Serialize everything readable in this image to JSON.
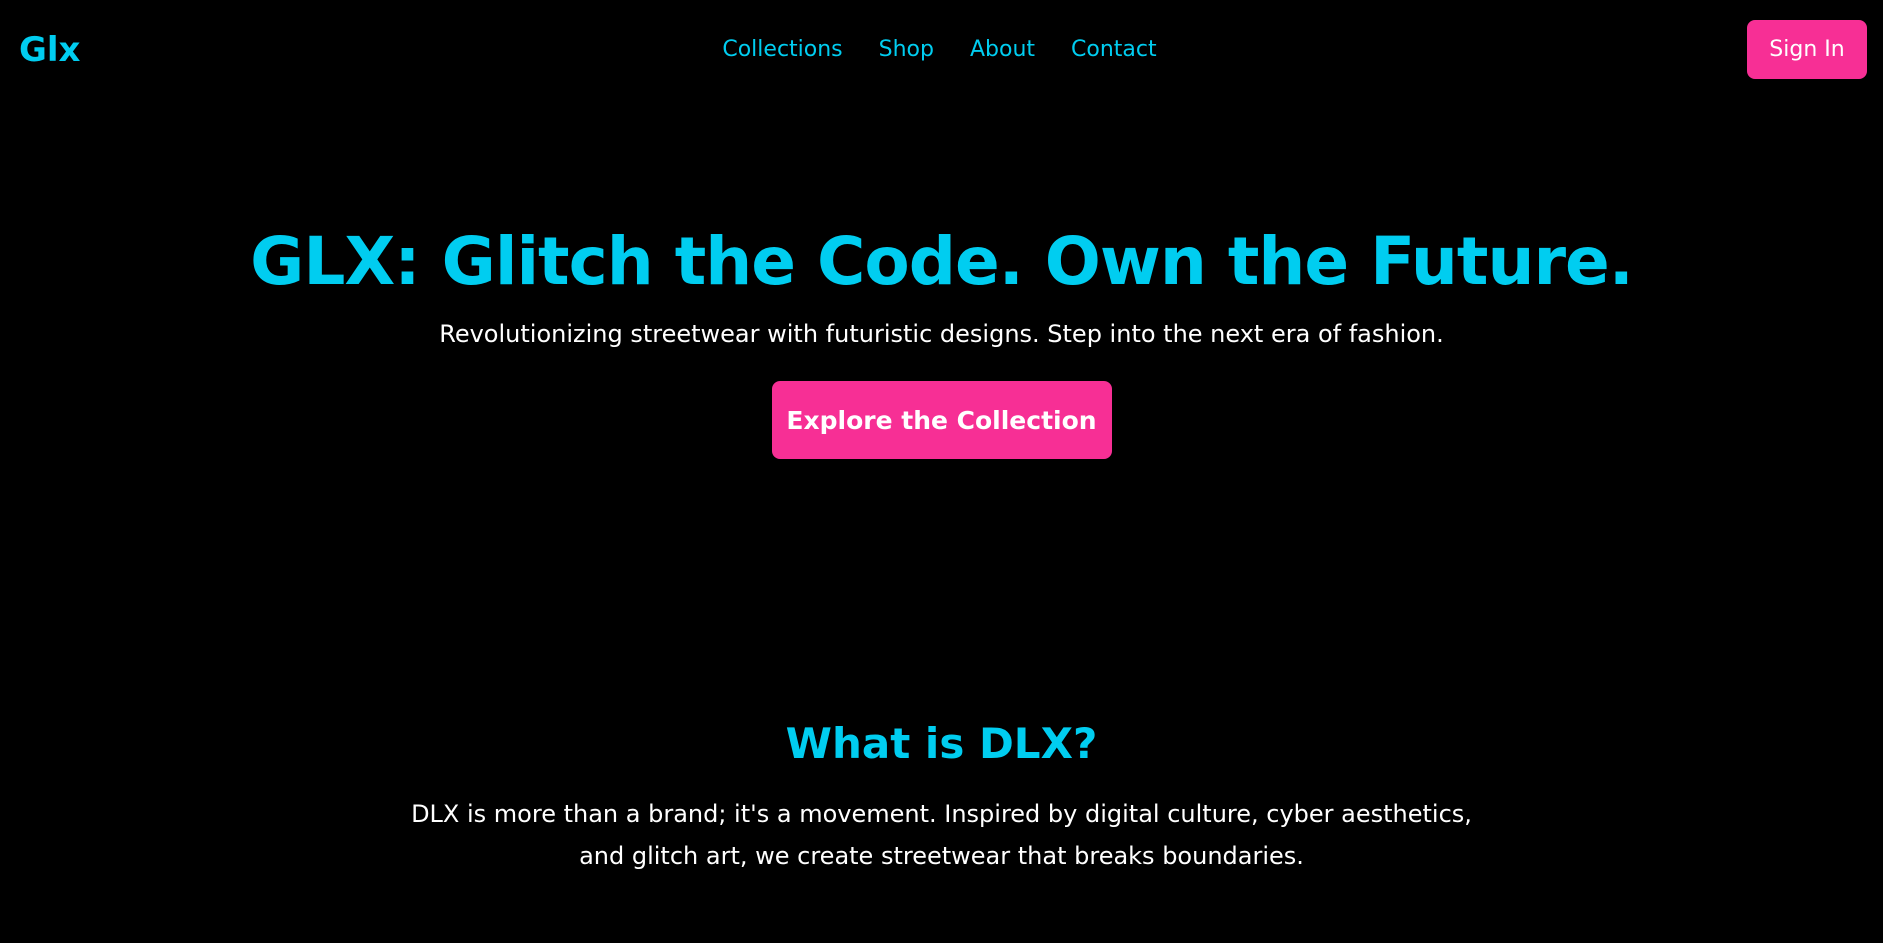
{
  "header": {
    "logo": "Glx",
    "nav": [
      {
        "label": "Collections"
      },
      {
        "label": "Shop"
      },
      {
        "label": "About"
      },
      {
        "label": "Contact"
      }
    ],
    "signin_label": "Sign In"
  },
  "hero": {
    "title": "GLX: Glitch the Code. Own the Future.",
    "subtitle": "Revolutionizing streetwear with futuristic designs. Step into the next era of fashion.",
    "cta_label": "Explore the Collection"
  },
  "about": {
    "title": "What is DLX?",
    "body": "DLX is more than a brand; it's a movement. Inspired by digital culture, cyber aesthetics, and glitch art, we create streetwear that breaks boundaries."
  },
  "colors": {
    "background": "#000000",
    "accent_cyan": "#00cdf0",
    "accent_pink": "#f72f95",
    "text": "#ffffff"
  }
}
